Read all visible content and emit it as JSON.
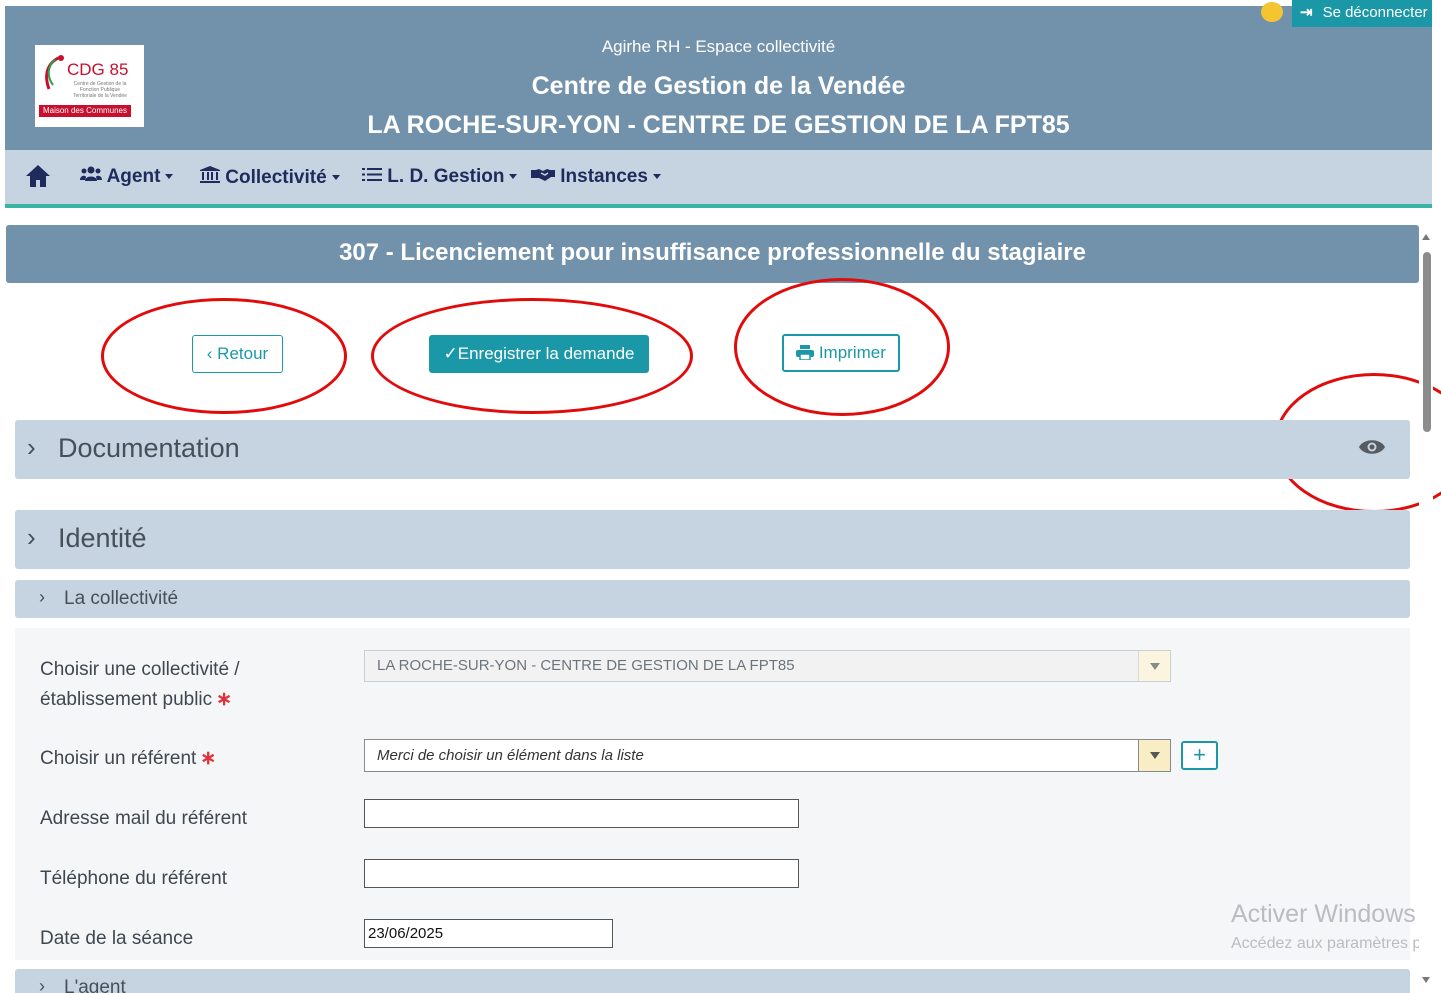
{
  "header": {
    "logo_text": "CDG 85",
    "logo_small_text": "Centre de Gestion de la Fonction Publique Territoriale de la Vendée",
    "logo_banner": "Maison des Communes",
    "app_name": "Agirhe RH - Espace collectivité",
    "center_name": "Centre de Gestion de la Vendée",
    "establishment": "LA ROCHE-SUR-YON - CENTRE DE GESTION DE LA FPT85",
    "logout_label": "Se déconnecter",
    "clock_icon": "clock-icon",
    "logout_icon": "sign-out-icon"
  },
  "nav": {
    "home_icon": "home-icon",
    "items": [
      {
        "label": "Agent",
        "icon": "users-icon"
      },
      {
        "label": "Collectivité",
        "icon": "bank-icon"
      },
      {
        "label": "L. D. Gestion",
        "icon": "list-icon"
      },
      {
        "label": "Instances",
        "icon": "handshake-icon"
      }
    ]
  },
  "page_title": "307 - Licenciement pour insuffisance professionnelle du stagiaire",
  "actions": {
    "back_label": "Retour",
    "save_label": "Enregistrer la demande",
    "print_label": "Imprimer"
  },
  "sections": {
    "documentation": "Documentation",
    "identity": "Identité",
    "collectivity": "La collectivité",
    "agent": "L'agent"
  },
  "form": {
    "collectivity_label_line1": "Choisir une collectivité /",
    "collectivity_label_line2": "établissement public",
    "collectivity_value": "LA ROCHE-SUR-YON - CENTRE DE GESTION DE LA FPT85",
    "referent_label": "Choisir un référent",
    "referent_placeholder": "Merci de choisir un élément dans la liste",
    "email_label": "Adresse mail du référent",
    "email_value": "",
    "phone_label": "Téléphone du référent",
    "phone_value": "",
    "date_label": "Date de la séance",
    "date_value": "23/06/2025",
    "required_mark": "∗",
    "add_label": "+"
  },
  "watermark": {
    "line1": "Activer Windows",
    "line2": "Accédez aux paramètres p"
  },
  "colors": {
    "header_bg": "#7292ab",
    "nav_bg": "#c5d4e0",
    "accent": "#1b98a8",
    "annotation": "#e20b0b"
  }
}
